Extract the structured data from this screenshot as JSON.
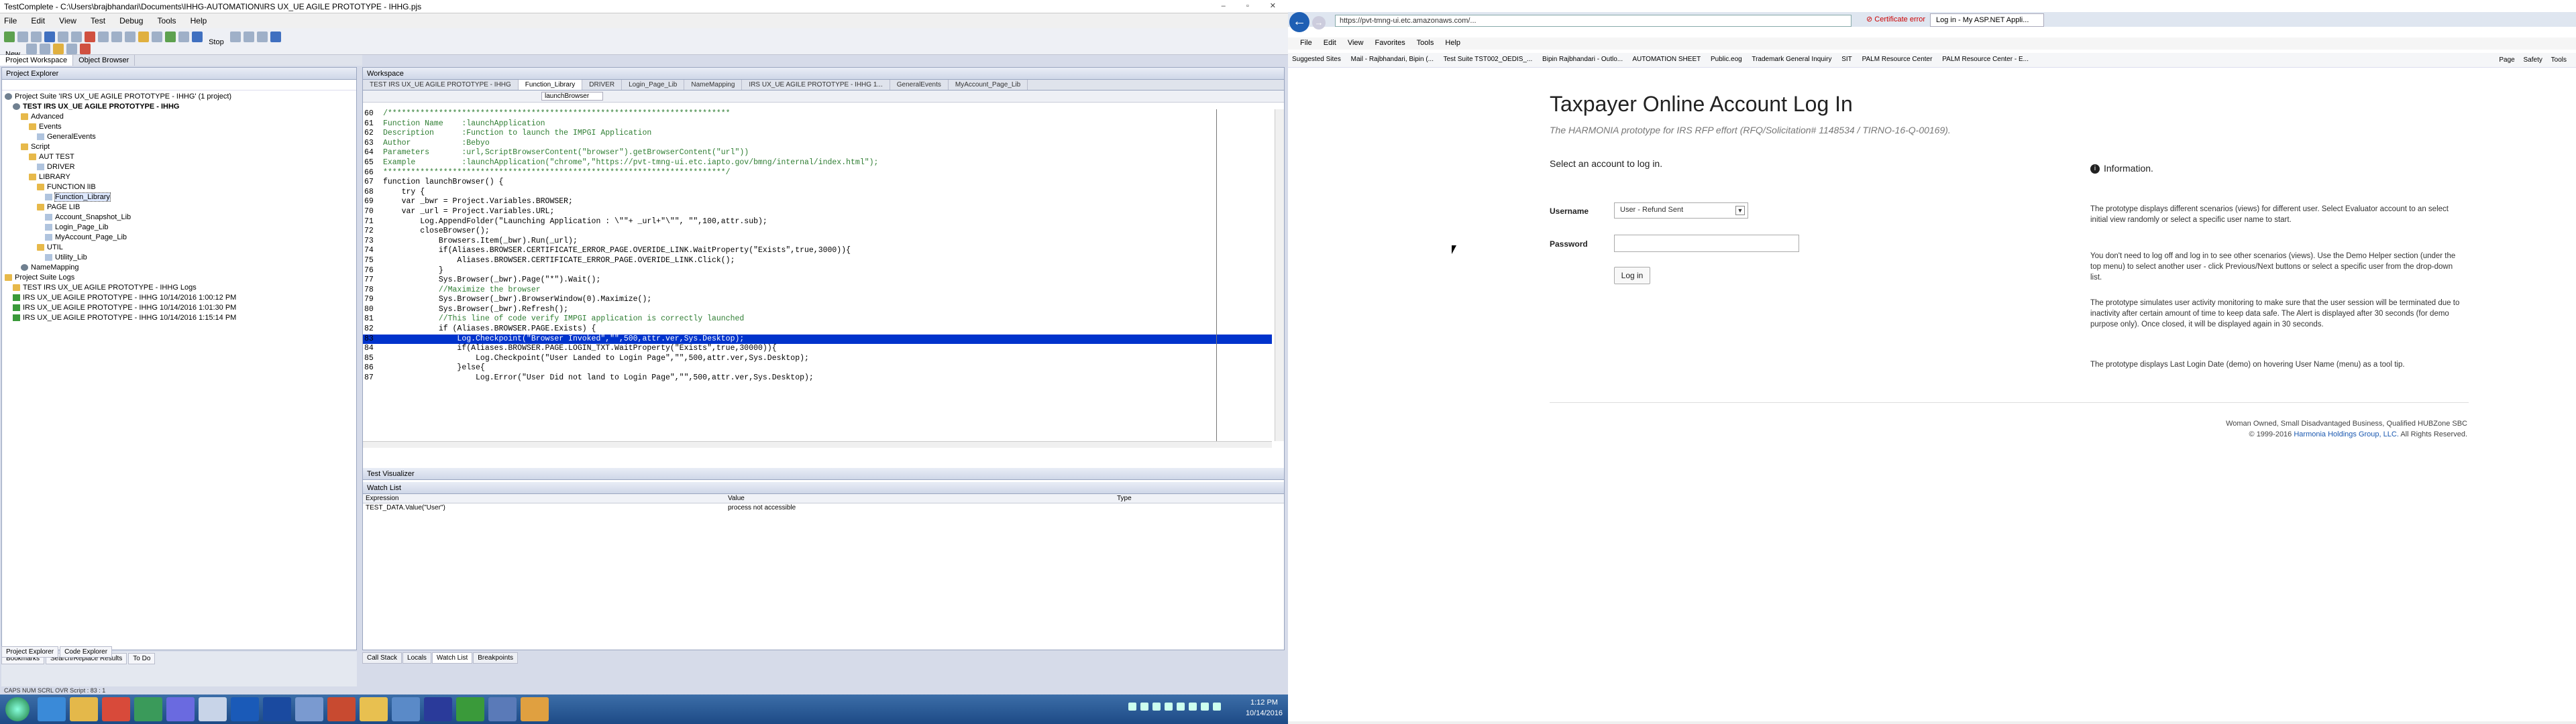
{
  "tc": {
    "title": "TestComplete - C:\\Users\\brajbhandari\\Documents\\IHHG-AUTOMATION\\IRS UX_UE AGILE PROTOTYPE - IHHG.pjs",
    "menu": [
      "File",
      "Edit",
      "View",
      "Test",
      "Debug",
      "Tools",
      "Help"
    ],
    "new_label": "New",
    "stop_label": "Stop",
    "left_tabs": [
      "Project Workspace",
      "Object Browser"
    ],
    "explorer_title": "Project Explorer",
    "tree": [
      {
        "label": "Project Suite 'IRS UX_UE AGILE PROTOTYPE - IHHG' (1 project)",
        "depth": 0,
        "icon": "gear"
      },
      {
        "label": "TEST IRS UX_UE AGILE PROTOTYPE - IHHG",
        "depth": 1,
        "icon": "gear",
        "bold": true
      },
      {
        "label": "Advanced",
        "depth": 2,
        "icon": "folder"
      },
      {
        "label": "Events",
        "depth": 3,
        "icon": "folder"
      },
      {
        "label": "GeneralEvents",
        "depth": 4,
        "icon": "doc"
      },
      {
        "label": "Script",
        "depth": 2,
        "icon": "folder"
      },
      {
        "label": "AUT TEST",
        "depth": 3,
        "icon": "folder"
      },
      {
        "label": "DRIVER",
        "depth": 4,
        "icon": "doc"
      },
      {
        "label": "LIBRARY",
        "depth": 3,
        "icon": "folder"
      },
      {
        "label": "FUNCTION lIB",
        "depth": 4,
        "icon": "folder"
      },
      {
        "label": "Function_Library",
        "depth": 5,
        "icon": "doc",
        "selected": true
      },
      {
        "label": "PAGE LIB",
        "depth": 4,
        "icon": "folder"
      },
      {
        "label": "Account_Snapshot_Lib",
        "depth": 5,
        "icon": "doc"
      },
      {
        "label": "Login_Page_Lib",
        "depth": 5,
        "icon": "doc"
      },
      {
        "label": "MyAccount_Page_Lib",
        "depth": 5,
        "icon": "doc"
      },
      {
        "label": "UTIL",
        "depth": 4,
        "icon": "folder"
      },
      {
        "label": "Utility_Lib",
        "depth": 5,
        "icon": "doc"
      },
      {
        "label": "NameMapping",
        "depth": 2,
        "icon": "gear"
      },
      {
        "label": "Project Suite Logs",
        "depth": 0,
        "icon": "folder"
      },
      {
        "label": "TEST IRS UX_UE AGILE PROTOTYPE - IHHG Logs",
        "depth": 1,
        "icon": "folder"
      },
      {
        "label": "IRS UX_UE AGILE PROTOTYPE - IHHG 10/14/2016 1:00:12 PM",
        "depth": 1,
        "icon": "check"
      },
      {
        "label": "IRS UX_UE AGILE PROTOTYPE - IHHG 10/14/2016 1:01:30 PM",
        "depth": 1,
        "icon": "check"
      },
      {
        "label": "IRS UX_UE AGILE PROTOTYPE - IHHG 10/14/2016 1:15:14 PM",
        "depth": 1,
        "icon": "check"
      }
    ],
    "explorer_bottom_tabs": [
      "Project Explorer",
      "Code Explorer"
    ],
    "bottom_tabs2": [
      "Bookmarks",
      "Search/Replace Results",
      "To Do"
    ],
    "workspace_title": "Workspace",
    "editor_tabs": [
      "TEST IRS UX_UE AGILE PROTOTYPE - IHHG",
      "Function_Library",
      "DRIVER",
      "Login_Page_Lib",
      "NameMapping",
      "IRS UX_UE AGILE PROTOTYPE - IHHG 1...",
      "GeneralEvents",
      "MyAccount_Page_Lib"
    ],
    "function_dropdown": "launchBrowser",
    "code": [
      {
        "n": "60",
        "t": "/**************************************************************************",
        "c": "cm"
      },
      {
        "n": "61",
        "t": "Function Name    :launchApplication",
        "c": "cm"
      },
      {
        "n": "62",
        "t": "Description      :Function to launch the IMPGI Application",
        "c": "cm"
      },
      {
        "n": "63",
        "t": "Author           :Bebyo",
        "c": "cm"
      },
      {
        "n": "64",
        "t": "Parameters       :url,ScriptBrowserContent(\"browser\").getBrowserContent(\"url\"))",
        "c": "cm"
      },
      {
        "n": "65",
        "t": "Example          :launchApplication(\"chrome\",\"https://pvt-tmng-ui.etc.iapto.gov/bmng/internal/index.html\");",
        "c": "cm"
      },
      {
        "n": "66",
        "t": "**************************************************************************/",
        "c": "cm"
      },
      {
        "n": "67",
        "t": "function launchBrowser() {",
        "c": "kw"
      },
      {
        "n": "68",
        "t": "    try {",
        "c": "kw"
      },
      {
        "n": "69",
        "t": "    var _bwr = Project.Variables.BROWSER;",
        "c": "kw"
      },
      {
        "n": "70",
        "t": "    var _url = Project.Variables.URL;",
        "c": "kw"
      },
      {
        "n": "71",
        "t": "        Log.AppendFolder(\"Launching Application : \\\"\"+ _url+\"\\\"\", \"\",100,attr.sub);",
        "c": "kw"
      },
      {
        "n": "72",
        "t": "        closeBrowser();",
        "c": "kw"
      },
      {
        "n": "73",
        "t": "            Browsers.Item(_bwr).Run(_url);",
        "c": "kw"
      },
      {
        "n": "74",
        "t": "            if(Aliases.BROWSER.CERTIFICATE_ERROR_PAGE.OVERIDE_LINK.WaitProperty(\"Exists\",true,3000)){",
        "c": "kw"
      },
      {
        "n": "75",
        "t": "                Aliases.BROWSER.CERTIFICATE_ERROR_PAGE.OVERIDE_LINK.Click();",
        "c": "kw"
      },
      {
        "n": "76",
        "t": "            }",
        "c": "kw"
      },
      {
        "n": "77",
        "t": "            Sys.Browser(_bwr).Page(\"*\").Wait();",
        "c": "kw"
      },
      {
        "n": "78",
        "t": "            //Maximize the browser",
        "c": "cm"
      },
      {
        "n": "79",
        "t": "            Sys.Browser(_bwr).BrowserWindow(0).Maximize();",
        "c": "kw"
      },
      {
        "n": "80",
        "t": "            Sys.Browser(_bwr).Refresh();",
        "c": "kw"
      },
      {
        "n": "81",
        "t": "            //This line of code verify IMPGI application is correctly launched",
        "c": "cm"
      },
      {
        "n": "82",
        "t": "            if (Aliases.BROWSER.PAGE.Exists) {",
        "c": "kw"
      },
      {
        "n": "83",
        "t": "                Log.Checkpoint(\"Browser Invoked\",\"\",500,attr.ver,Sys.Desktop);",
        "c": "hl"
      },
      {
        "n": "84",
        "t": "                if(Aliases.BROWSER.PAGE.LOGIN_TXT.WaitProperty(\"Exists\",true,30000)){",
        "c": "kw"
      },
      {
        "n": "85",
        "t": "                    Log.Checkpoint(\"User Landed to Login Page\",\"\",500,attr.ver,Sys.Desktop);",
        "c": "kw"
      },
      {
        "n": "86",
        "t": "                }else{",
        "c": "kw"
      },
      {
        "n": "87",
        "t": "                    Log.Error(\"User Did not land to Login Page\",\"\",500,attr.ver,Sys.Desktop);",
        "c": "kw"
      }
    ],
    "test_visualizer": "Test Visualizer",
    "watch_title": "Watch List",
    "watch_headers": [
      "Expression",
      "Value",
      "Type"
    ],
    "watch_rows": [
      {
        "expr": "TEST_DATA.Value(\"User\")",
        "value": "process not accessible",
        "type": ""
      }
    ],
    "ws_bottom_tabs": [
      "Call Stack",
      "Locals",
      "Watch List",
      "Breakpoints"
    ],
    "status": "CAPS  NUM  SCRL  OVR  Script : 83 : 1"
  },
  "ie": {
    "address": "https://pvt-tmng-ui.etc.amazonaws.com/...",
    "cert_error": "Certificate error",
    "tab_title": "Log in - My ASP.NET Appli...",
    "menu": [
      "File",
      "Edit",
      "View",
      "Favorites",
      "Tools",
      "Help"
    ],
    "favorites": [
      "Suggested Sites",
      "Mail - Rajbhandari, Bipin (...",
      "Test Suite TST002_OEDIS_...",
      "Bipin Rajbhandari - Outlo...",
      "AUTOMATION SHEET",
      "Public.eog",
      "Trademark General Inquiry",
      "SIT",
      "PALM Resource Center",
      "PALM Resource Center - E..."
    ],
    "commands": [
      "Page",
      "Safety",
      "Tools"
    ],
    "page": {
      "title": "Taxpayer Online Account Log In",
      "subtitle": "The HARMONIA prototype for IRS RFP effort (RFQ/Solicitation# 1148534 / TIRNO-16-Q-00169).",
      "select_prompt": "Select an account to log in.",
      "username_label": "Username",
      "username_value": "User - Refund Sent",
      "password_label": "Password",
      "login_button": "Log in",
      "info_title": "Information.",
      "info_p1": "The prototype displays different scenarios (views) for different user. Select Evaluator account to an select initial view randomly or select a specific user name to start.",
      "info_p2": "You don't need to log off and log in to see other scenarios (views). Use the Demo Helper section (under the top menu) to select another user - click Previous/Next buttons or select a specific user from the drop-down list.",
      "info_p3": "The prototype simulates user activity monitoring to make sure that the user session will be terminated due to inactivity after certain amount of time to keep data safe. The Alert is displayed after 30 seconds (for demo purpose only). Once closed, it will be displayed again in 30 seconds.",
      "info_p4": "The prototype displays Last Login Date (demo) on hovering User Name (menu) as a tool tip.",
      "footer_line1": "Woman Owned, Small Disadvantaged Business, Qualified HUBZone SBC",
      "footer_copy": "© 1999-2016",
      "footer_link": "Harmonia Holdings Group, LLC.",
      "footer_rights": "All Rights Reserved."
    }
  },
  "taskbar": {
    "time": "1:12 PM",
    "date": "10/14/2016"
  }
}
